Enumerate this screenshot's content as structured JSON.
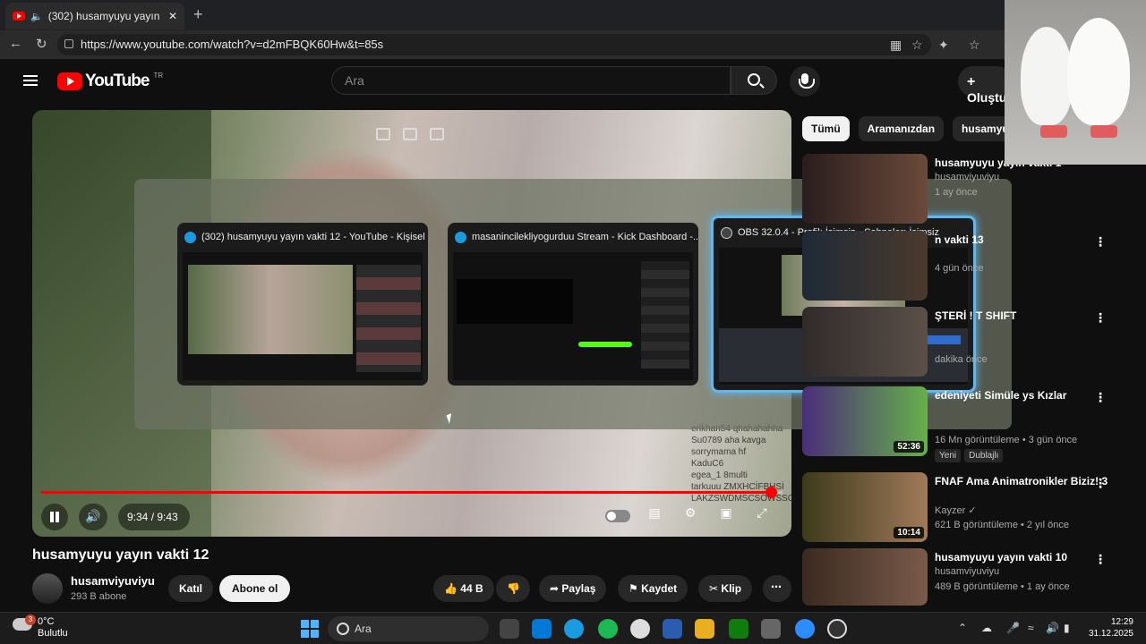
{
  "browser": {
    "tab_title": "(302) husamyuyu yayın vakti 12",
    "url": "https://www.youtube.com/watch?v=d2mFBQK60Hw&t=85s"
  },
  "youtube": {
    "logo_text": "YouTube",
    "region": "TR",
    "search_placeholder": "Ara",
    "create_label": "Oluştur"
  },
  "player": {
    "time": "9:34 / 9:43",
    "progress": 0.984,
    "chat_lines": [
      "erikhan54 qhahahahha",
      "Su0789 aha kavga",
      "sorrymama hf",
      "KaduC6",
      "egea_1 8multi",
      "tarkuuu ZMXHCİFBHSİ",
      "LAKZSWDMSCSOWSSC"
    ]
  },
  "switcher": {
    "windows": [
      {
        "title": "(302) husamyuyu yayın vakti 12 - YouTube - Kişisel -..."
      },
      {
        "title": "masanincilekliyogurduu Stream - Kick Dashboard -..."
      },
      {
        "title": "OBS 32.0.4 - Profil: İsimsiz - Sahneler: İsimsiz"
      }
    ]
  },
  "video": {
    "title": "husamyuyu yayın vakti 12",
    "channel": "husamviyuviyu",
    "subscribers": "293 B abone",
    "join_label": "Katıl",
    "subscribe_label": "Abone ol",
    "likes": "44 B",
    "share_label": "Paylaş",
    "save_label": "Kaydet",
    "clip_label": "Klip"
  },
  "chips": [
    "Tümü",
    "Aramanızdan",
    "husamyuyu"
  ],
  "recommendations": [
    {
      "title": "husamyuyu yayın vakti 1",
      "channel": "husamviyuviyu",
      "meta": "1 ay önce",
      "duration": ""
    },
    {
      "title": "n vakti 13",
      "channel": "",
      "meta": "4 gün önce",
      "duration": ""
    },
    {
      "title": "ŞTERİ ! T SHIFT",
      "channel": "",
      "meta": "dakika önce",
      "duration": ""
    },
    {
      "title": "edeniyeti Simüle ys Kızlar",
      "channel": "",
      "meta": "16 Mn görüntüleme • 3 gün önce",
      "duration": "52:36",
      "tag1": "Yeni",
      "tag2": "Dublajlı"
    },
    {
      "title": "FNAF Ama Animatronikler Biziz! 3",
      "channel": "Kayzer",
      "meta": "621 B görüntüleme • 2 yıl önce",
      "duration": "10:14"
    },
    {
      "title": "husamyuyu yayın vakti 10",
      "channel": "husamviyuviyu",
      "meta": "489 B görüntüleme • 1 ay önce",
      "duration": ""
    }
  ],
  "taskbar": {
    "weather_temp": "0°C",
    "weather_desc": "Bulutlu",
    "weather_badge": "3",
    "search_label": "Ara",
    "time": "12:29",
    "date": "31.12.2025"
  }
}
